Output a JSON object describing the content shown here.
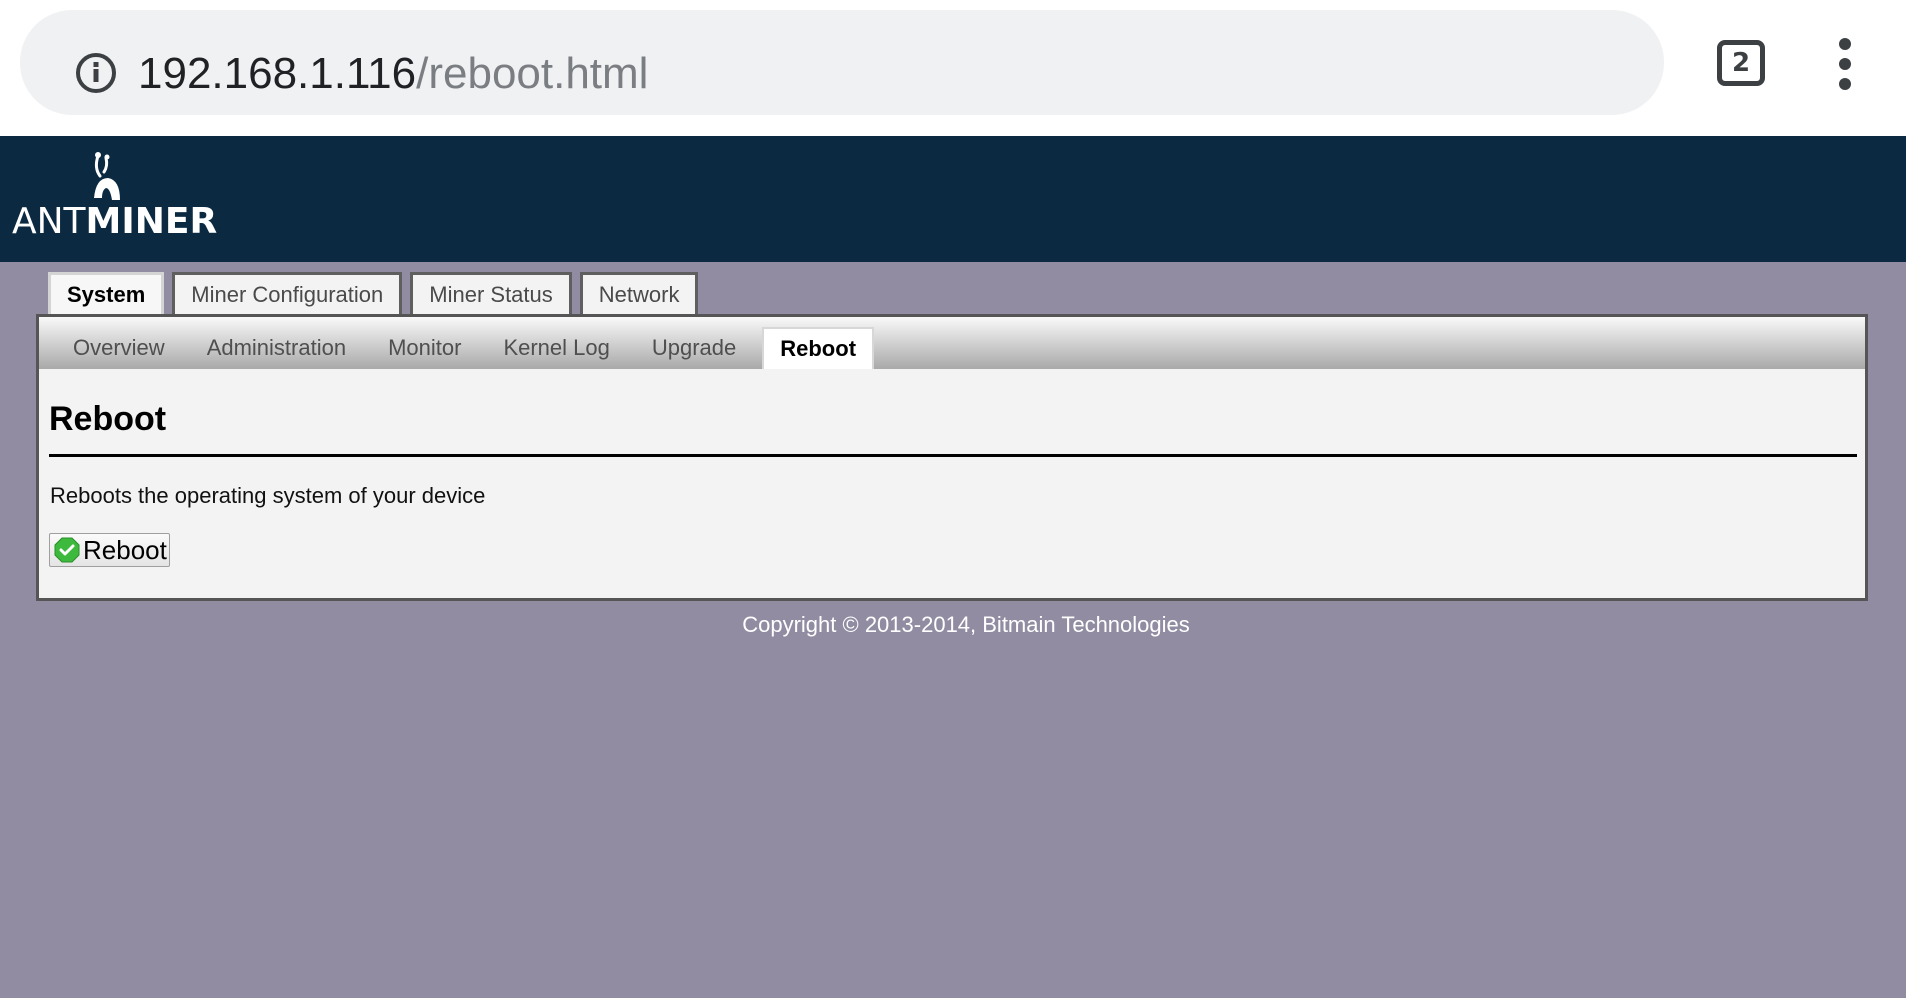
{
  "browser": {
    "url_host": "192.168.1.116",
    "url_path": "/reboot.html",
    "tab_count": "2",
    "icons": [
      "info-icon",
      "tab-switcher-icon",
      "more-vert-icon"
    ]
  },
  "header": {
    "logo_ant": "ANT",
    "logo_miner": "MINER",
    "background": "#0b2a42"
  },
  "main_tabs": [
    {
      "label": "System",
      "active": true
    },
    {
      "label": "Miner Configuration",
      "active": false
    },
    {
      "label": "Miner Status",
      "active": false
    },
    {
      "label": "Network",
      "active": false
    }
  ],
  "sub_tabs": [
    {
      "label": "Overview",
      "active": false
    },
    {
      "label": "Administration",
      "active": false
    },
    {
      "label": "Monitor",
      "active": false
    },
    {
      "label": "Kernel Log",
      "active": false
    },
    {
      "label": "Upgrade",
      "active": false
    },
    {
      "label": "Reboot",
      "active": true
    }
  ],
  "content": {
    "title": "Reboot",
    "description": "Reboots the operating system of your device",
    "button_label": "Reboot",
    "button_icon": "check-circle-icon"
  },
  "footer": {
    "copyright": "Copyright © 2013-2014, Bitmain Technologies"
  },
  "colors": {
    "page_background": "#918ca2",
    "header_background": "#0b2a42",
    "panel_background": "#f3f3f3",
    "button_icon": "#3dba3d"
  }
}
